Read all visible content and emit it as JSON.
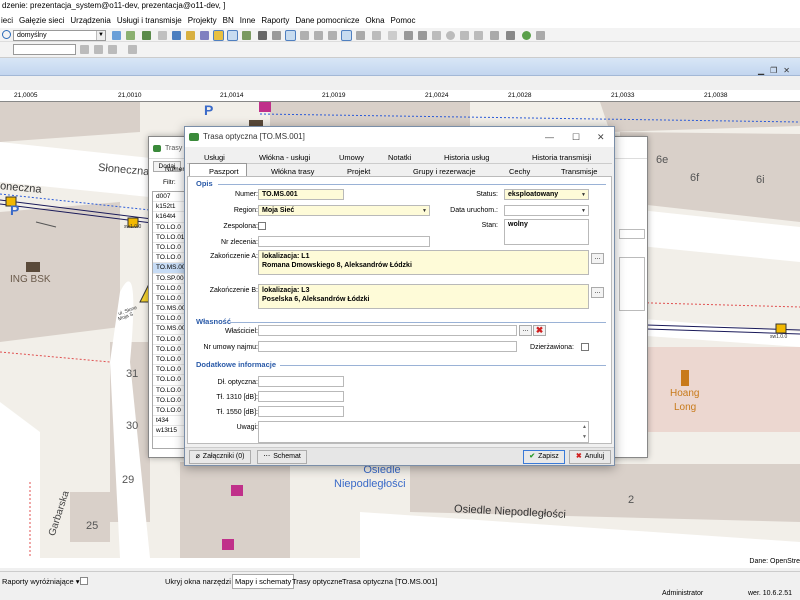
{
  "window": {
    "title": "dzenie: prezentacja_system@o11-dev, prezentacja@o11-dev, ]"
  },
  "menu": [
    "ieci",
    "Gałęzie sieci",
    "Urządzenia",
    "Usługi i transmisje",
    "Projekty",
    "BN",
    "Inne",
    "Raporty",
    "Dane pomocnicze",
    "Okna",
    "Pomoc"
  ],
  "toolbar": {
    "layer_combo": "domyślny"
  },
  "ruler": [
    "21,0005",
    "21,0010",
    "21,0014",
    "21,0019",
    "21,0024",
    "21,0028",
    "21,0033",
    "21,0038"
  ],
  "map": {
    "streets": [
      "Słoneczna",
      "oneczna",
      "Garbarska",
      "Osiedle Niepodległości"
    ],
    "district": [
      "Osiedle",
      "Niepodległości"
    ],
    "buildings": [
      "6e",
      "6f",
      "6i",
      "31",
      "30",
      "29",
      "25",
      "2"
    ],
    "poi": [
      {
        "name": "ING BSK"
      },
      {
        "name": "Hoang"
      },
      {
        "name": "Long"
      }
    ],
    "points": [
      "P"
    ],
    "small_labels": [
      "ul. Słone",
      "Moja S",
      "sw1.0.0",
      "sw1.0.0"
    ]
  },
  "map_status": {
    "attribution": "Dane: OpenStre"
  },
  "bg_dialog": {
    "title": "Trasy",
    "add_label": "Dodaj",
    "filter_label": "Filtr:",
    "column_header": "Numer",
    "rows": [
      "d007",
      "k152t1",
      "k164t4",
      "TO.LO.0",
      "TO.LO.01",
      "TO.LO.0",
      "TO.LO.0",
      "TO.MS.00",
      "TO.SP.00",
      "TO.LO.0",
      "TO.LO.0",
      "TO.MS.00",
      "TO.LO.0",
      "TO.MS.00",
      "TO.LO.0",
      "TO.LO.0",
      "TO.LO.0",
      "TO.LO.0",
      "TO.LO.0",
      "TO.LO.0",
      "TO.LO.0",
      "TO.LO.0",
      "t434",
      "w13t15"
    ],
    "selected_index": 7
  },
  "dialog": {
    "title": "Trasa optyczna [TO.MS.001]",
    "tabs_row1": [
      "Usługi",
      "Włókna - usługi",
      "Umowy",
      "Notatki",
      "Historia usług",
      "Historia transmisji"
    ],
    "tabs_row2": [
      "Paszport",
      "Włókna trasy",
      "Projekt",
      "Grupy i rezerwacje",
      "Cechy",
      "Transmisje"
    ],
    "sections": {
      "opis": "Opis",
      "wlasnosc": "Własność",
      "dodatkowe": "Dodatkowe informacje"
    },
    "labels": {
      "numer": "Numer:",
      "region": "Region:",
      "zespolona": "Zespolona:",
      "nr_zlecenia": "Nr zlecenia:",
      "zak_a": "Zakończenie A:",
      "zak_b": "Zakończenie B:",
      "status": "Status:",
      "data_uruch": "Data uruchom.:",
      "stan": "Stan:",
      "wlasciciel": "Właściciel:",
      "nr_umowy": "Nr umowy najmu:",
      "dzierzawiona": "Dzierżawiona:",
      "dl_optyczna": "Dł. optyczna:",
      "tl1310": "Tł. 1310 [dB]:",
      "tl1550": "Tł. 1550 [dB]:",
      "uwagi": "Uwagi:"
    },
    "values": {
      "numer": "TO.MS.001",
      "region": "Moja Sieć",
      "status": "eksploatowany",
      "stan": "wolny",
      "zak_a_line1": "lokalizacja: L1",
      "zak_a_line2": "Romana Dmowskiego 8, Aleksandrów Łódzki",
      "zak_b_line1": "lokalizacja: L3",
      "zak_b_line2": "Poselska 6, Aleksandrów Łódzki"
    },
    "ellipsis": "...",
    "buttons": {
      "zalaczniki": "Załączniki (0)",
      "schemat": "Schemat",
      "zapisz": "Zapisz",
      "anuluj": "Anuluj"
    }
  },
  "bottom": {
    "reports": "Raporty wyróżniające",
    "ukryj": "Ukryj okna narzędzi",
    "tabs": [
      "Mapy i schematy",
      "Trasy optyczne",
      "Trasa optyczna [TO.MS.001]"
    ],
    "user": "Administrator",
    "version": "wer. 10.6.2.51"
  },
  "colors": {
    "accent": "#2a5aa8",
    "required_field": "#fefbd8",
    "road": "#ffffff",
    "building": "#d9d0c9"
  }
}
